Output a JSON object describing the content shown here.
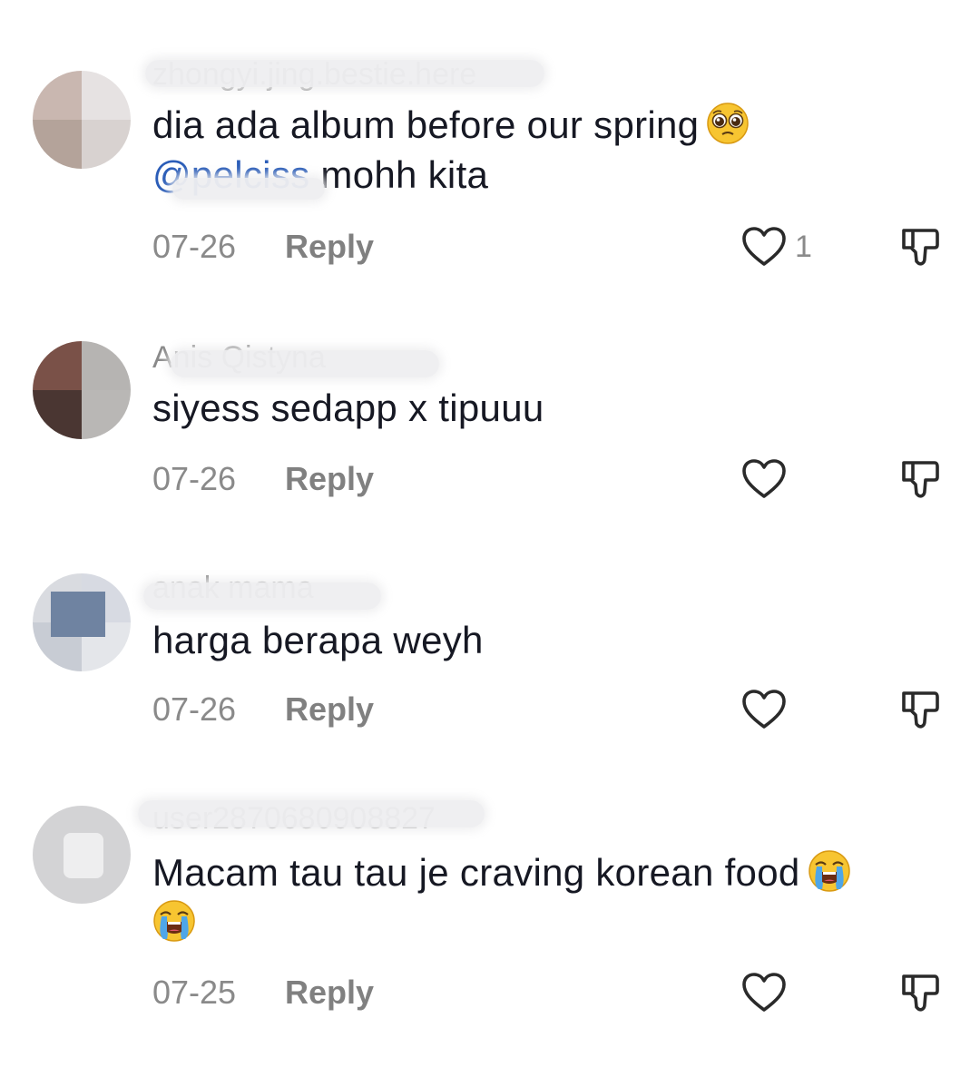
{
  "colors": {
    "text": "#161823",
    "secondary": "#8a8a8a",
    "mention": "#2b5db8",
    "background": "#ffffff"
  },
  "comments": [
    {
      "username": "zhongyi.jing.bestie.here",
      "text": "dia ada album before our spring",
      "emoji": "pleading-face-emoji",
      "mention": "@pelciss",
      "text_after_mention": "mohh kita",
      "date": "07-26",
      "reply_label": "Reply",
      "likes": "1"
    },
    {
      "username": "Anis Qistyna",
      "text": "siyess sedapp x tipuuu",
      "date": "07-26",
      "reply_label": "Reply",
      "likes": ""
    },
    {
      "username": "anak mama",
      "text": "harga berapa weyh",
      "date": "07-26",
      "reply_label": "Reply",
      "likes": ""
    },
    {
      "username": "user2870680908827",
      "text": "Macam tau tau je craving korean food",
      "emoji": "loudly-crying-face-emoji",
      "date": "07-25",
      "reply_label": "Reply",
      "likes": ""
    }
  ],
  "icons": {
    "like": "heart-outline-icon",
    "dislike": "thumbs-down-outline-icon"
  }
}
